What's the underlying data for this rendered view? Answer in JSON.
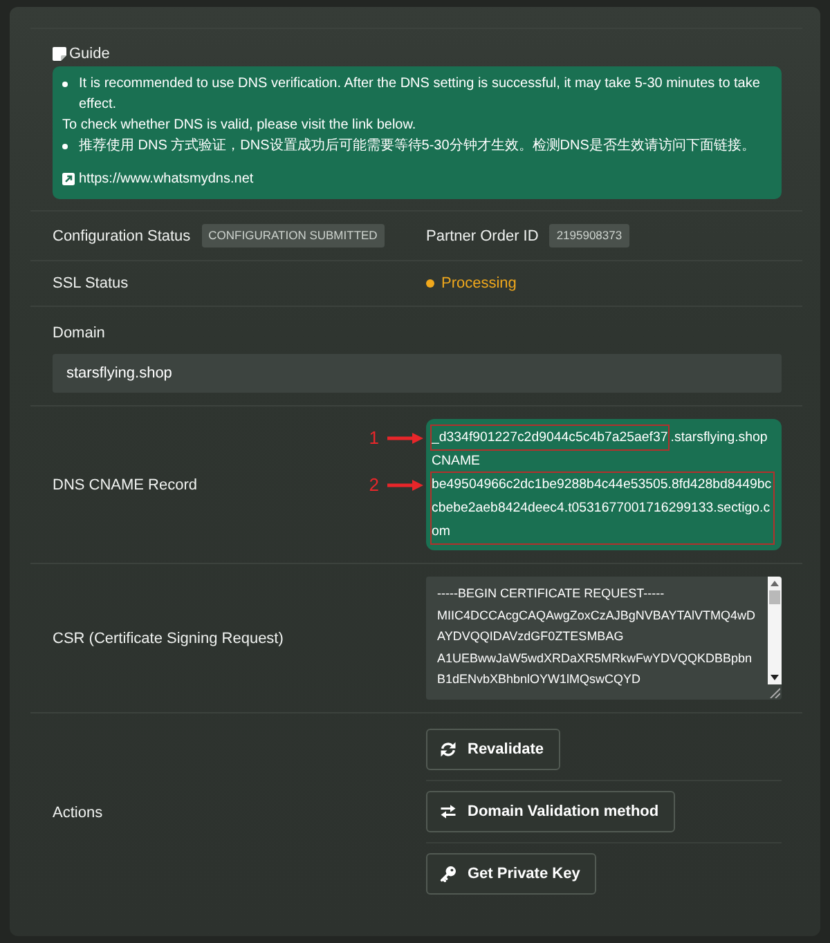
{
  "guide": {
    "title": "Guide",
    "lines": [
      {
        "kind": "bullet",
        "text": "It is recommended to use DNS verification. After the DNS setting is successful, it may take 5-30 minutes to take effect."
      },
      {
        "kind": "plain",
        "text": "To check whether DNS is valid, please visit the link below."
      },
      {
        "kind": "bullet",
        "text": "推荐使用 DNS 方式验证，DNS设置成功后可能需要等待5-30分钟才生效。检测DNS是否生效请访问下面链接。"
      }
    ],
    "link": "https://www.whatsmydns.net"
  },
  "configuration": {
    "label": "Configuration Status",
    "status": "CONFIGURATION SUBMITTED",
    "order_label": "Partner Order ID",
    "order_id": "2195908373"
  },
  "ssl": {
    "label": "SSL Status",
    "status": {
      "text": "Processing",
      "kind": "pending"
    }
  },
  "domain": {
    "label": "Domain",
    "value": "starsflying.shop"
  },
  "dns_record": {
    "label": "DNS CNAME Record",
    "host": {
      "marker": "1",
      "parts": [
        {
          "text": "_d334f901227c2d9044c5c4b7a25aef37",
          "highlighted": true
        },
        {
          "text": ".starsflying.shop",
          "highlighted": false
        }
      ]
    },
    "type": "CNAME",
    "value": {
      "marker": "2",
      "parts": [
        {
          "text": "be49504966c2dc1be9288b4c44e53505.8fd428bd8449bccbebe2aeb8424deec4.t0531677001716299133.sectigo.com",
          "highlighted": true
        }
      ]
    }
  },
  "csr": {
    "label": "CSR (Certificate Signing Request)",
    "lines": [
      "-----BEGIN CERTIFICATE REQUEST-----",
      "MIIC4DCCAcgCAQAwgZoxCzAJBgNVBAYTAlVTMQ4wD",
      "AYDVQQIDAVzdGF0ZTESMBAG",
      "A1UEBwwJaW5wdXRDaXR5MRkwFwYDVQQKDBBpbn",
      "B1dENvbXBhbnlOYW1lMQswCQYD"
    ]
  },
  "actions": {
    "label": "Actions",
    "buttons": [
      {
        "kind": "revalidate",
        "label": "Revalidate"
      },
      {
        "kind": "switch",
        "label": "Domain Validation method"
      },
      {
        "kind": "key",
        "label": "Get Private Key"
      }
    ]
  }
}
